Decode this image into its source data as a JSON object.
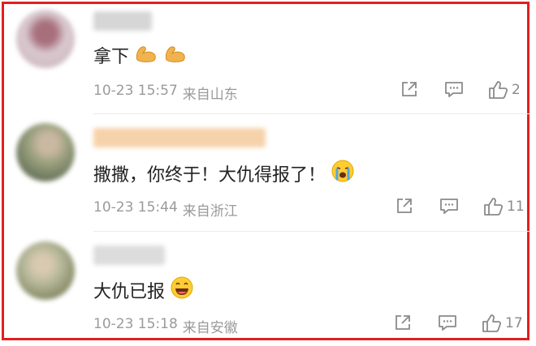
{
  "comments": [
    {
      "text": "拿下",
      "emojis": [
        "flexed-biceps-icon",
        "flexed-biceps-icon"
      ],
      "time": "10-23 15:57",
      "location": "来自山东",
      "like_count": "2",
      "avatar_colors": [
        "#d9c9cf",
        "#a76f7c",
        "#c8b2b8"
      ],
      "username_color": "#d6d6d6"
    },
    {
      "text": "撒撒，你终于！大仇得报了！",
      "emojis": [
        "loudly-crying-face-icon"
      ],
      "time": "10-23 15:44",
      "location": "来自浙江",
      "like_count": "11",
      "avatar_colors": [
        "#6f7a5f",
        "#9aa07e",
        "#4f5a44"
      ],
      "username_color": "#f6d2aa"
    },
    {
      "text": "大仇已报",
      "emojis": [
        "laughing-face-icon"
      ],
      "time": "10-23 15:18",
      "location": "来自安徽",
      "like_count": "17",
      "avatar_colors": [
        "#8c8f6a",
        "#b5b79a",
        "#5e6a48"
      ],
      "username_color": "#dcdcdc"
    }
  ],
  "colors": {
    "frame": "#e0201f",
    "meta_text": "#9a9a9a",
    "content_text": "#222222"
  }
}
